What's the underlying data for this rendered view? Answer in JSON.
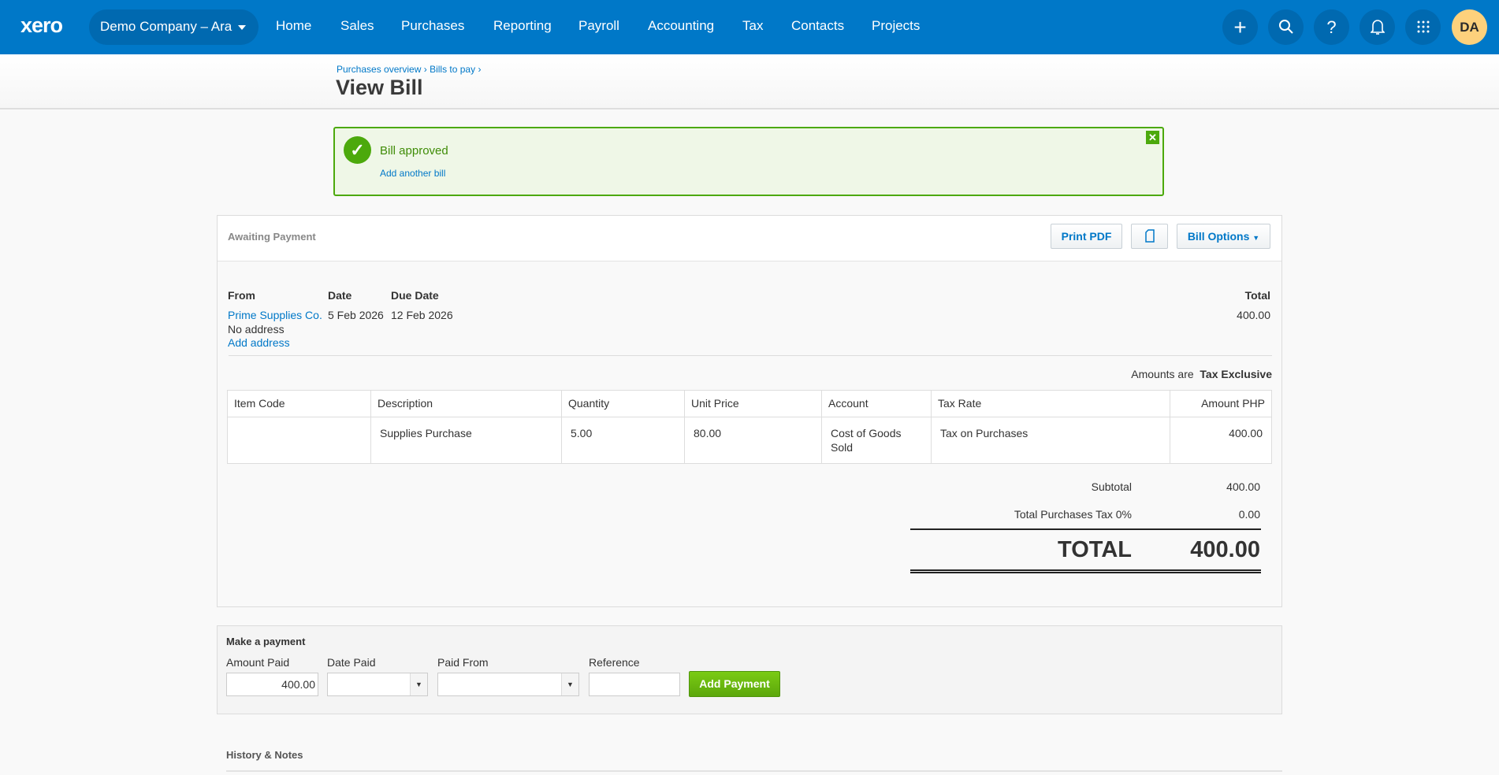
{
  "topbar": {
    "logo": "xero",
    "org": "Demo Company – Ara",
    "nav": [
      "Home",
      "Sales",
      "Purchases",
      "Reporting",
      "Payroll",
      "Accounting",
      "Tax",
      "Contacts",
      "Projects"
    ],
    "icons": [
      "plus-icon",
      "search-icon",
      "help-icon",
      "bell-icon",
      "apps-grid-icon"
    ],
    "avatar": "DA"
  },
  "header": {
    "breadcrumb": [
      "Purchases overview",
      "Bills to pay"
    ],
    "sep": "›",
    "title": "View Bill"
  },
  "alert": {
    "message": "Bill approved",
    "link": "Add another bill",
    "close": "✕"
  },
  "bill": {
    "status": "Awaiting Payment",
    "buttons": {
      "print": "Print PDF",
      "options": "Bill Options"
    },
    "from_label": "From",
    "date_label": "Date",
    "due_label": "Due Date",
    "total_label": "Total",
    "from": "Prime Supplies Co.",
    "address": "No address",
    "add_address": "Add address",
    "date": "5 Feb 2026",
    "due": "12 Feb 2026",
    "total": "400.00",
    "amounts_are": "Amounts are",
    "tax_mode": "Tax Exclusive",
    "columns": [
      "Item Code",
      "Description",
      "Quantity",
      "Unit Price",
      "Account",
      "Tax Rate",
      "Amount PHP"
    ],
    "rows": [
      [
        "",
        "Supplies Purchase",
        "5.00",
        "80.00",
        "Cost of Goods Sold",
        "Tax on Purchases",
        "400.00"
      ]
    ],
    "subtotal_label": "Subtotal",
    "subtotal": "400.00",
    "tax_label": "Total Purchases Tax 0%",
    "tax": "0.00",
    "grand_label": "TOTAL",
    "grand": "400.00"
  },
  "payment": {
    "title": "Make a payment",
    "amount_label": "Amount Paid",
    "amount": "400.00",
    "date_label": "Date Paid",
    "from_label": "Paid From",
    "ref_label": "Reference",
    "button": "Add Payment"
  },
  "history": {
    "title": "History & Notes"
  }
}
